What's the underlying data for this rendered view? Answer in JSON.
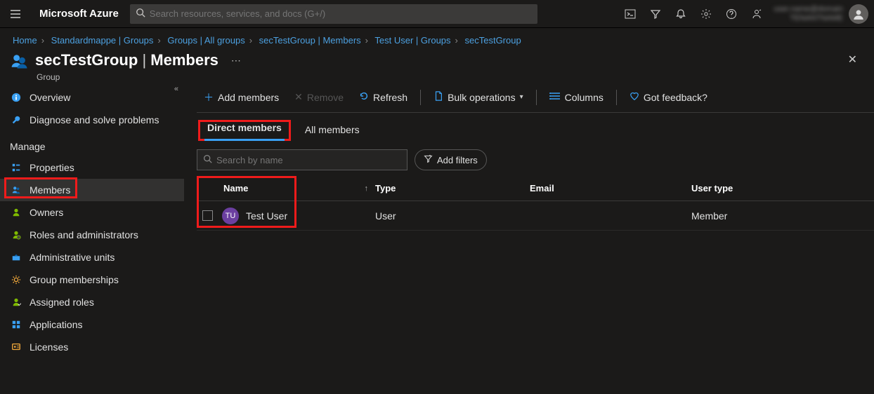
{
  "topbar": {
    "brand": "Microsoft Azure",
    "search_placeholder": "Search resources, services, and docs (G+/)"
  },
  "breadcrumb": {
    "items": [
      "Home",
      "Standardmappe | Groups",
      "Groups | All groups",
      "secTestGroup | Members",
      "Test User | Groups",
      "secTestGroup"
    ]
  },
  "header": {
    "group_name": "secTestGroup",
    "section": "Members",
    "subtitle": "Group"
  },
  "sidebar": {
    "overview": "Overview",
    "diagnose": "Diagnose and solve problems",
    "manage_header": "Manage",
    "manage": [
      "Properties",
      "Members",
      "Owners",
      "Roles and administrators",
      "Administrative units",
      "Group memberships",
      "Assigned roles",
      "Applications",
      "Licenses"
    ]
  },
  "toolbar": {
    "add": "Add members",
    "remove": "Remove",
    "refresh": "Refresh",
    "bulk": "Bulk operations",
    "columns": "Columns",
    "feedback": "Got feedback?"
  },
  "tabs": {
    "direct": "Direct members",
    "all": "All members"
  },
  "filters": {
    "search_placeholder": "Search by name",
    "add_filters": "Add filters"
  },
  "table": {
    "headers": {
      "name": "Name",
      "type": "Type",
      "email": "Email",
      "usertype": "User type"
    },
    "rows": [
      {
        "initials": "TU",
        "name": "Test User",
        "type": "User",
        "email": "",
        "usertype": "Member"
      }
    ]
  }
}
